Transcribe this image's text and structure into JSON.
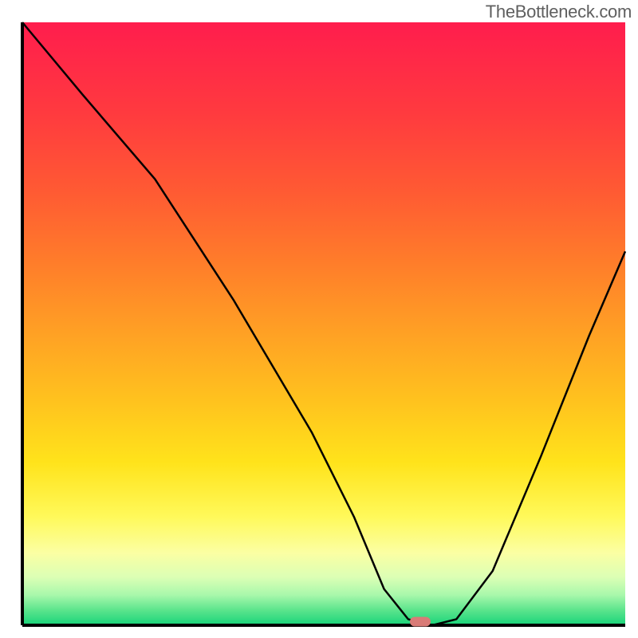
{
  "watermark": "TheBottleneck.com",
  "chart_data": {
    "type": "line",
    "title": "",
    "xlabel": "",
    "ylabel": "",
    "xlim": [
      0,
      100
    ],
    "ylim": [
      0,
      100
    ],
    "x": [
      0,
      10,
      22,
      35,
      48,
      55,
      60,
      64,
      68,
      72,
      78,
      86,
      94,
      100
    ],
    "values": [
      100,
      88,
      74,
      54,
      32,
      18,
      6,
      1,
      0,
      1,
      9,
      28,
      48,
      62
    ],
    "marker": {
      "x": 66,
      "y": 0.6,
      "color": "#d97b77"
    },
    "gradient_stops": [
      {
        "offset": 0.0,
        "color": "#ff1d4d"
      },
      {
        "offset": 0.15,
        "color": "#ff3a3f"
      },
      {
        "offset": 0.28,
        "color": "#ff5a33"
      },
      {
        "offset": 0.4,
        "color": "#ff7d2a"
      },
      {
        "offset": 0.52,
        "color": "#ffa224"
      },
      {
        "offset": 0.63,
        "color": "#ffc31e"
      },
      {
        "offset": 0.73,
        "color": "#ffe31b"
      },
      {
        "offset": 0.82,
        "color": "#fff95a"
      },
      {
        "offset": 0.88,
        "color": "#fbffa3"
      },
      {
        "offset": 0.92,
        "color": "#dcffb5"
      },
      {
        "offset": 0.95,
        "color": "#a8f8ab"
      },
      {
        "offset": 0.975,
        "color": "#5be48c"
      },
      {
        "offset": 1.0,
        "color": "#18d47a"
      }
    ],
    "axis_color": "#000000",
    "line_color": "#000000",
    "line_width": 2.5
  },
  "plot": {
    "outer_w": 800,
    "outer_h": 800,
    "inner_x": 28,
    "inner_y": 28,
    "inner_w": 756,
    "inner_h": 756
  }
}
